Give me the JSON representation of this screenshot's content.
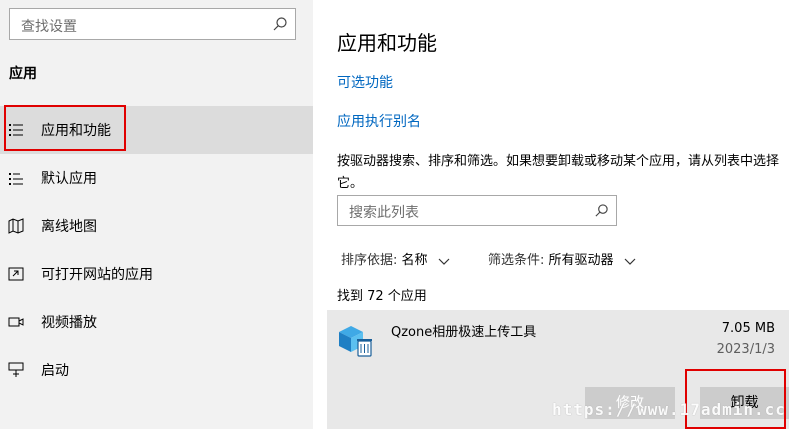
{
  "nav": {
    "search_placeholder": "查找设置",
    "heading": "应用",
    "items": [
      {
        "label": "应用和功能",
        "icon": "apps-features-icon",
        "selected": true
      },
      {
        "label": "默认应用",
        "icon": "default-apps-icon"
      },
      {
        "label": "离线地图",
        "icon": "offline-maps-icon"
      },
      {
        "label": "可打开网站的应用",
        "icon": "apps-for-websites-icon"
      },
      {
        "label": "视频播放",
        "icon": "video-playback-icon"
      },
      {
        "label": "启动",
        "icon": "startup-icon"
      }
    ]
  },
  "main": {
    "title": "应用和功能",
    "link_optional": "可选功能",
    "link_alias": "应用执行别名",
    "description": "按驱动器搜索、排序和筛选。如果想要卸载或移动某个应用，请从列表中选择它。",
    "search_placeholder": "搜索此列表",
    "sort_label": "排序依据:",
    "sort_value": "名称",
    "filter_label": "筛选条件:",
    "filter_value": "所有驱动器",
    "count_text": "找到 72 个应用",
    "app": {
      "name": "Qzone相册极速上传工具",
      "size": "7.05 MB",
      "date": "2023/1/3",
      "modify_label": "修改",
      "uninstall_label": "卸载",
      "icon": "qzone-uploader-icon"
    }
  },
  "watermark": "https://www.17admin.cc",
  "colors": {
    "accent": "#0067c0",
    "highlight": "#e00000",
    "nav_bg": "#f2f2f2",
    "selected_bg": "#dcdcdc"
  }
}
